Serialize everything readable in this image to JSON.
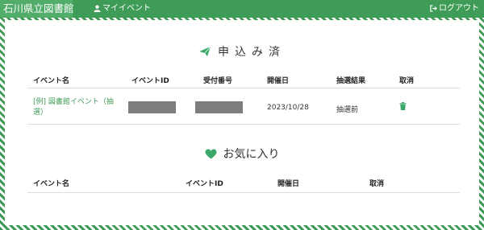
{
  "nav": {
    "brand": "石川県立図書館",
    "myevent_label": "マイイベント",
    "logout_label": "ログアウト"
  },
  "applied": {
    "title": "申込み済",
    "columns": [
      "イベント名",
      "イベントID",
      "受付番号",
      "開催日",
      "抽選結果",
      "取消"
    ],
    "rows": [
      {
        "event_name": "[例] 図書館イベント（抽選）",
        "event_id": "",
        "receipt_no": "",
        "date": "2023/10/28",
        "lottery_result": "抽選前"
      }
    ]
  },
  "favorites": {
    "title": "お気に入り",
    "columns": [
      "イベント名",
      "イベントID",
      "開催日",
      "取消"
    ]
  },
  "colors": {
    "brand_green": "#3f9c57",
    "accent_green": "#3aa86b",
    "masked": "#7d7d7d"
  }
}
